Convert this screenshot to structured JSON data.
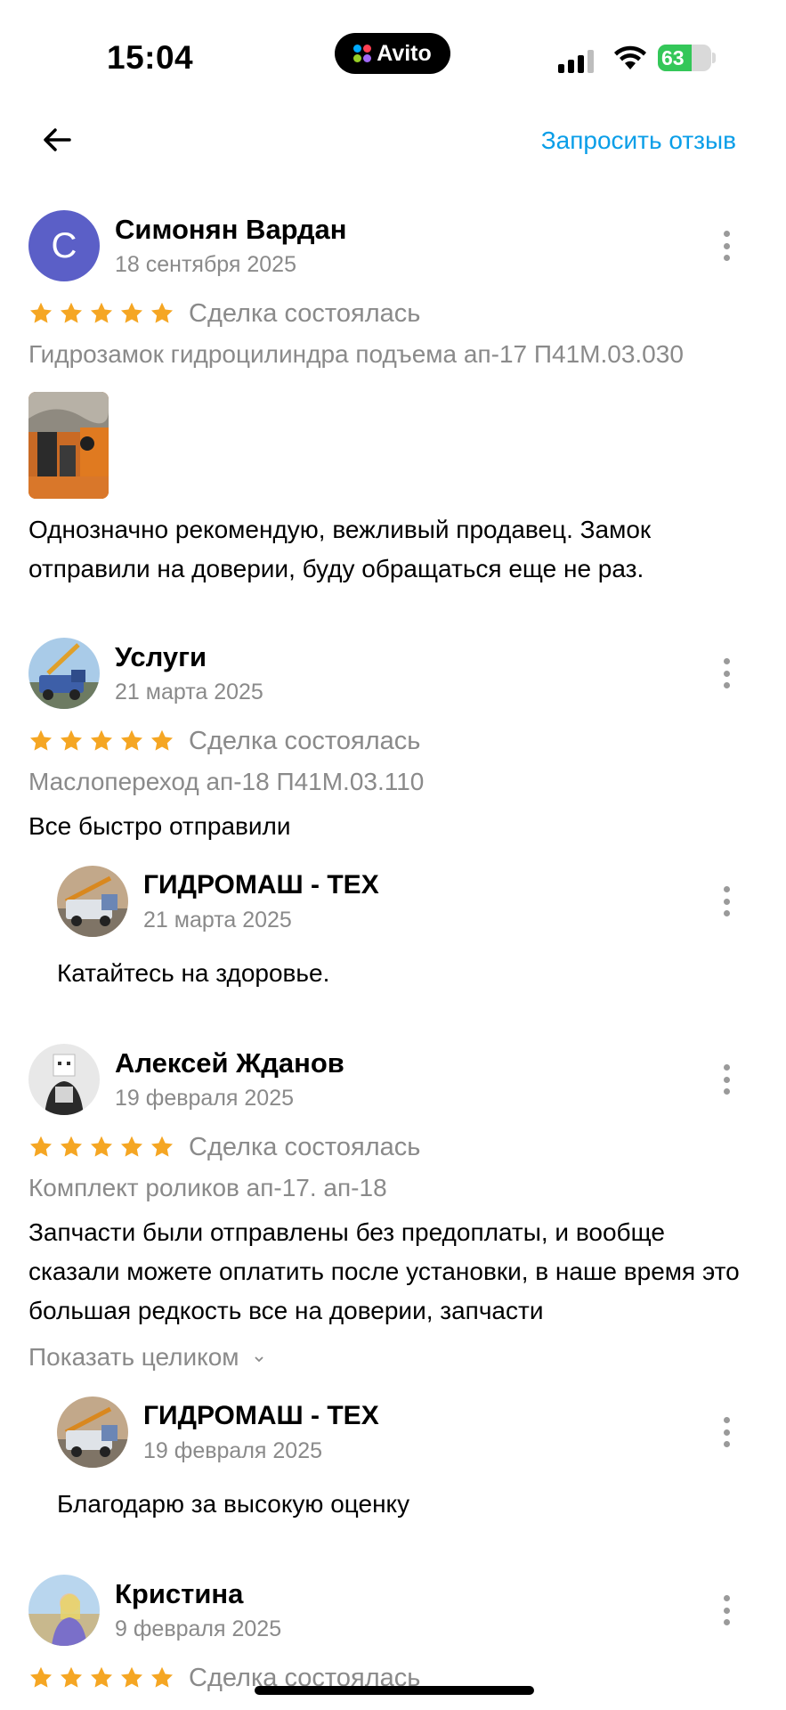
{
  "status_bar": {
    "time": "15:04",
    "island_brand": "Avito",
    "battery_percent": 63,
    "battery_label": "63"
  },
  "header": {
    "back_icon": "arrow-left-icon",
    "request_label": "Запросить отзыв"
  },
  "reviews": [
    {
      "author": "Симонян Вардан",
      "avatar_letter": "С",
      "date": "18 сентября 2025",
      "rating": 5,
      "deal": "Сделка состоялась",
      "item": "Гидрозамок гидроцилиндра подъема ап-17 П41М.03.030",
      "text": "Однозначно рекомендую, вежливый продавец. Замок отправили на доверии, буду обращаться еще не раз."
    },
    {
      "author": "Услуги",
      "date": "21 марта 2025",
      "rating": 5,
      "deal": "Сделка состоялась",
      "item": "Маслопереход ап-18 П41М.03.110",
      "text": "Все быстро отправили",
      "reply": {
        "author": "ГИДРОМАШ - ТЕХ",
        "date": "21 марта 2025",
        "text": "Катайтесь на здоровье."
      }
    },
    {
      "author": "Алексей Жданов",
      "date": "19 февраля 2025",
      "rating": 5,
      "deal": "Сделка состоялась",
      "item": "Комплект роликов ап-17. ап-18",
      "text": "Запчасти были отправлены без предоплаты, и вообще сказали можете оплатить после установки, в наше время это большая редкость все на доверии, запчасти",
      "show_more": "Показать целиком",
      "reply": {
        "author": "ГИДРОМАШ - ТЕХ",
        "date": "19 февраля 2025",
        "text": "Благодарю за высокую оценку"
      }
    },
    {
      "author": "Кристина",
      "date": "9 февраля 2025",
      "rating": 5,
      "deal": "Сделка состоялась"
    }
  ],
  "colors": {
    "accent_link": "#0a9ee8",
    "star": "#f5a623",
    "muted_text": "#8a8a8a",
    "avatar_letter_bg": "#5b5fc7",
    "battery_green": "#34c759"
  }
}
